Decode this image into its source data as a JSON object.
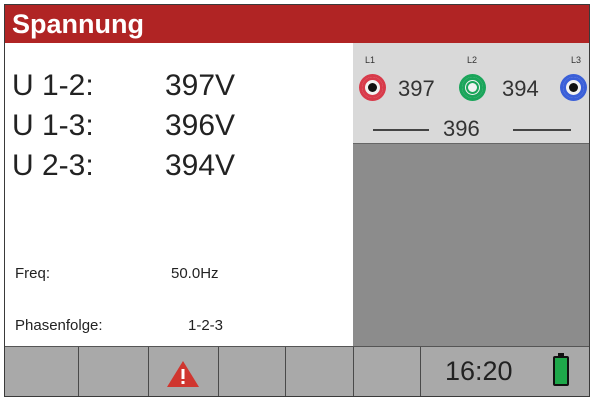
{
  "title": "Spannung",
  "readings": [
    {
      "label": "U 1-2:",
      "value": "397V"
    },
    {
      "label": "U 1-3:",
      "value": "396V"
    },
    {
      "label": "U 2-3:",
      "value": "394V"
    }
  ],
  "freq": {
    "label": "Freq:",
    "value": "50.0Hz"
  },
  "phase_sequence": {
    "label": "Phasenfolge:",
    "value": "1-2-3"
  },
  "diagram": {
    "phases": [
      {
        "label": "L1",
        "color": "#d83a4a"
      },
      {
        "label": "L2",
        "color": "#1aa55a"
      },
      {
        "label": "L3",
        "color": "#3a5fd8"
      }
    ],
    "u12": "397",
    "u23": "394",
    "u13": "396"
  },
  "footer": {
    "clock": "16:20",
    "warning_icon": "warning-triangle-icon",
    "battery_icon": "battery-full-icon",
    "battery_color": "#1ea84a"
  },
  "colors": {
    "title_bar": "#b02424",
    "panel": "#8c8c8c",
    "footer": "#a9a9a9"
  }
}
